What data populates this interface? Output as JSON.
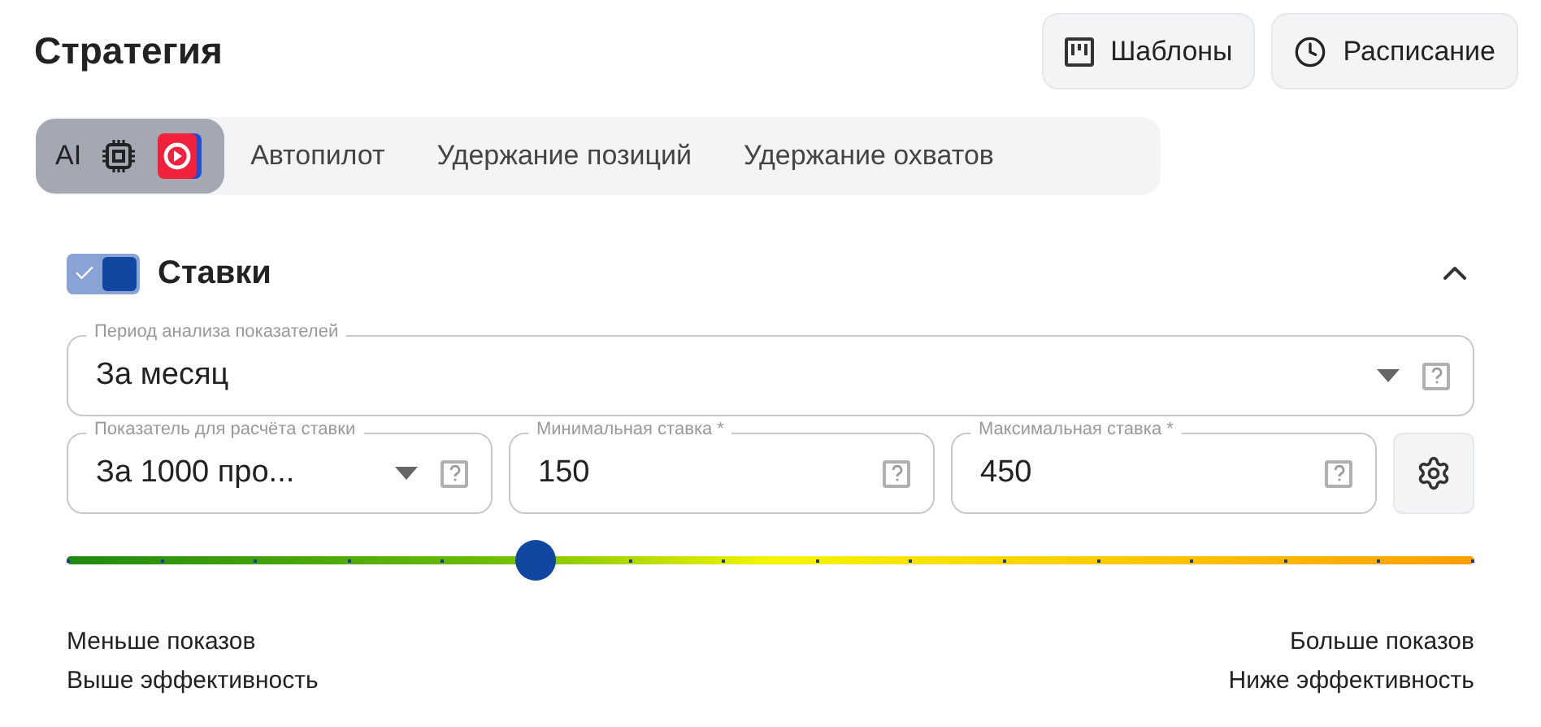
{
  "title": "Стратегия",
  "header_buttons": [
    {
      "kind": "templates",
      "label": "Шаблоны"
    },
    {
      "kind": "schedule",
      "label": "Расписание"
    }
  ],
  "tabs": [
    {
      "kind": "ai",
      "label": "AI",
      "selected": true
    },
    {
      "kind": "text",
      "label": "Автопилот",
      "selected": false
    },
    {
      "kind": "text",
      "label": "Удержание позиций",
      "selected": false
    },
    {
      "kind": "text",
      "label": "Удержание охватов",
      "selected": false
    }
  ],
  "section": {
    "title": "Ставки",
    "enabled": true,
    "expanded": true
  },
  "period_field": {
    "label": "Период анализа показателей",
    "value": "За месяц"
  },
  "fields": [
    {
      "kind": "select",
      "label": "Показатель для расчёта ставки",
      "value": "За 1000 про..."
    },
    {
      "kind": "input",
      "label": "Минимальная ставка *",
      "value": "150"
    },
    {
      "kind": "input",
      "label": "Максимальная ставка *",
      "value": "450"
    }
  ],
  "slider": {
    "level": 0.333
  },
  "scale_left": [
    "Меньше показов",
    "Выше эффективность"
  ],
  "scale_right": [
    "Больше показов",
    "Ниже эффективность"
  ]
}
